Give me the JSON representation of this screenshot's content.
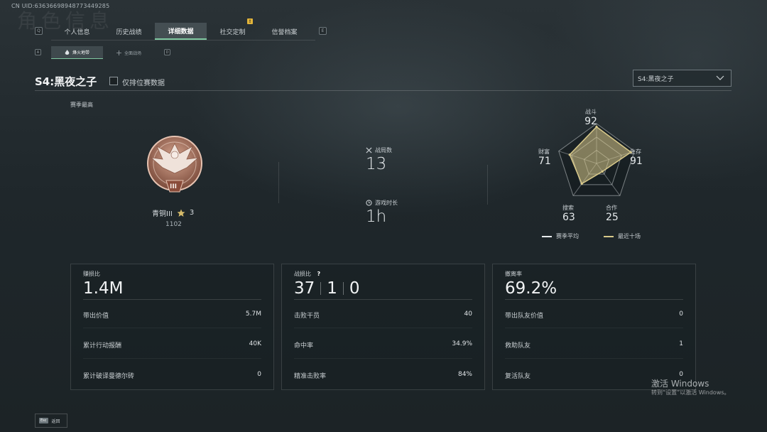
{
  "uid_text": "CN UID:6363669894877344928​5",
  "bg_title": "角色信息",
  "hint_keys": {
    "left_tab": "Q",
    "right_tab": "E",
    "left_sub": "A",
    "right_sub": "D"
  },
  "tabs": [
    {
      "label": "个人信息"
    },
    {
      "label": "历史战绩"
    },
    {
      "label": "详细数据",
      "active": true
    },
    {
      "label": "社交定制"
    },
    {
      "label": "信誉档案",
      "notif": "!"
    }
  ],
  "subtabs": [
    {
      "label": "烽火地带",
      "icon": "flame-icon",
      "active": true
    },
    {
      "label": "全面战场",
      "icon": "crosshair-icon"
    }
  ],
  "season": {
    "title": "S4:黑夜之子",
    "ranked_only_label": "仅排位赛数据",
    "select_value": "S4:黑夜之子"
  },
  "rank": {
    "section_label": "赛季最高",
    "name": "青铜III",
    "stars": "3",
    "score": "1102",
    "badge_numeral": "III"
  },
  "overview": {
    "matches_label": "战局数",
    "matches_value": "13",
    "playtime_label": "游戏时长",
    "playtime_value": "1h"
  },
  "radar": {
    "axes": [
      {
        "label": "战斗",
        "value": "92"
      },
      {
        "label": "生存",
        "value": "91"
      },
      {
        "label": "合作",
        "value": "25"
      },
      {
        "label": "搜索",
        "value": "63"
      },
      {
        "label": "财富",
        "value": "71"
      }
    ],
    "values_fraction": [
      0.92,
      0.91,
      0.25,
      0.63,
      0.71
    ],
    "legend_avg": "赛季平均",
    "legend_recent": "最近十场",
    "color_avg": "#e8ecee",
    "color_recent": "#d8c98a"
  },
  "cards": [
    {
      "head": "赚损比",
      "big": "1.4M",
      "rows": [
        {
          "label": "带出价值",
          "value": "5.7M"
        },
        {
          "label": "累计行动报酬",
          "value": "40K"
        },
        {
          "label": "累计破译曼德尔砖",
          "value": "0"
        }
      ]
    },
    {
      "head": "战损比",
      "help": "?",
      "big_parts": [
        "37",
        "1",
        "0"
      ],
      "rows": [
        {
          "label": "击败干员",
          "value": "40"
        },
        {
          "label": "命中率",
          "value": "34.9%"
        },
        {
          "label": "精准击败率",
          "value": "84%"
        }
      ]
    },
    {
      "head": "撤离率",
      "big": "69.2%",
      "rows": [
        {
          "label": "带出队友价值",
          "value": "0"
        },
        {
          "label": "救助队友",
          "value": "1"
        },
        {
          "label": "复活队友",
          "value": "0"
        }
      ]
    }
  ],
  "footer": {
    "esc_key": "Esc",
    "back_label": "返回"
  },
  "watermark": {
    "line1": "激活 Windows",
    "line2": "转到“设置”以激活 Windows。"
  },
  "colors": {
    "accent": "#7fc8a0",
    "notif": "#e2b43a"
  }
}
